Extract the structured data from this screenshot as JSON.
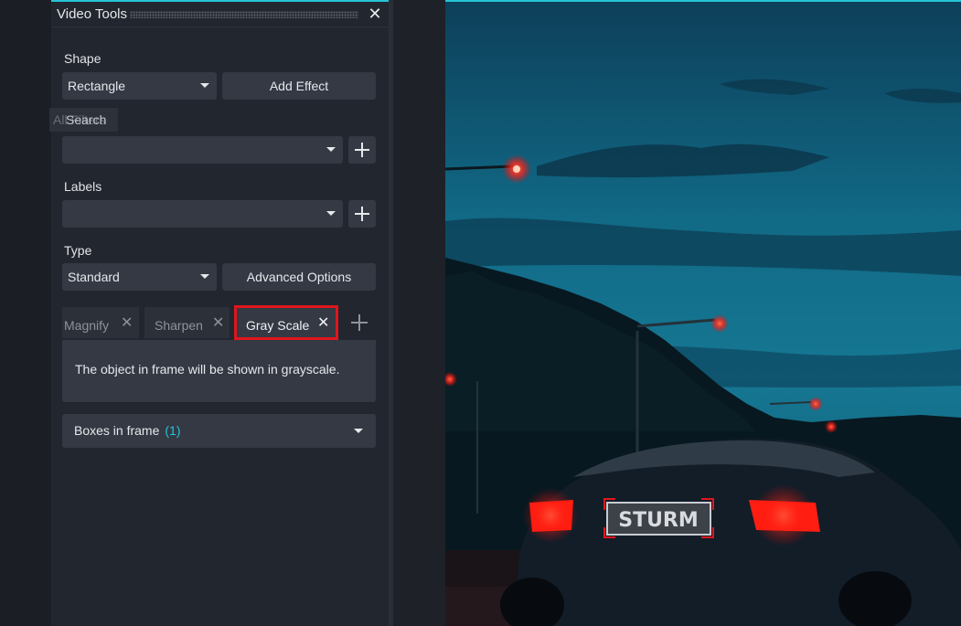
{
  "tooltip": {
    "back_text": "All Filters",
    "front_text": "Search"
  },
  "panel": {
    "title": "Video Tools",
    "shape": {
      "label": "Shape",
      "selected": "Rectangle",
      "add_effect_label": "Add Effect"
    },
    "search": {
      "selected": ""
    },
    "labels": {
      "label": "Labels",
      "selected": ""
    },
    "type": {
      "label": "Type",
      "selected": "Standard",
      "advanced_label": "Advanced Options"
    },
    "effect_tabs": [
      {
        "label": "Magnify"
      },
      {
        "label": "Sharpen"
      },
      {
        "label": "Gray Scale"
      }
    ],
    "effect_description": "The object in frame will be shown in grayscale.",
    "boxes": {
      "label": "Boxes in frame",
      "count": "(1)"
    }
  },
  "photo": {
    "plate_text": "STURM"
  },
  "colors": {
    "accent": "#27c3d6",
    "highlight": "#e0161d",
    "panel_bg": "#22262e",
    "control_bg": "#343944"
  }
}
